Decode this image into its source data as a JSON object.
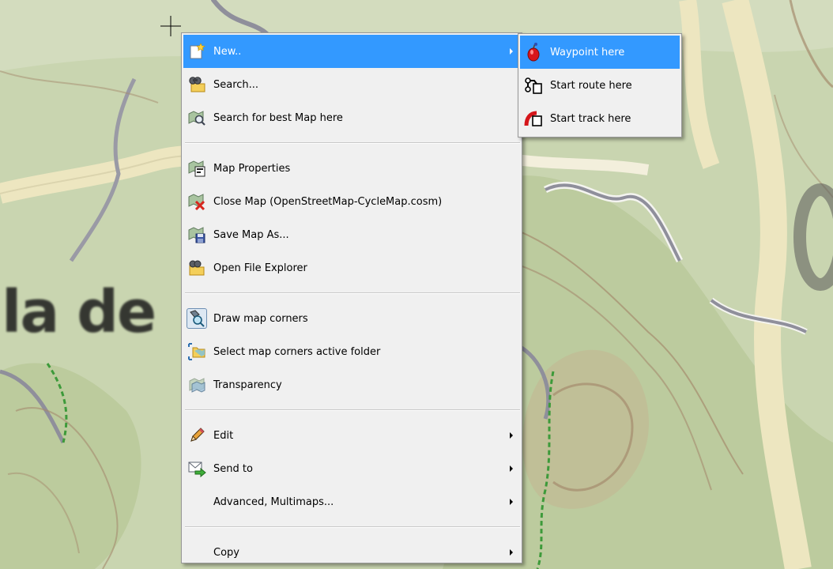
{
  "map": {
    "label_text": "la de",
    "colors": {
      "background": "#c7d3ad",
      "road": "#ede6c0",
      "contour": "#a58b6e",
      "boundary": "#8f8f9b",
      "trail": "#3d9a3a"
    }
  },
  "context_menu": {
    "items": [
      {
        "label": "New..",
        "icon": "new-item-icon",
        "submenu": true,
        "highlighted": true
      },
      {
        "label": "Search...",
        "icon": "search-folder-icon"
      },
      {
        "label": "Search for best Map here",
        "icon": "search-map-icon"
      },
      {
        "label": "Map Properties",
        "icon": "map-properties-icon"
      },
      {
        "label": "Close Map  (OpenStreetMap-CycleMap.cosm)",
        "icon": "close-map-icon"
      },
      {
        "label": "Save Map As...",
        "icon": "save-map-icon"
      },
      {
        "label": "Open File Explorer",
        "icon": "open-folder-icon"
      },
      {
        "label": "Draw map corners",
        "icon": "draw-corners-icon"
      },
      {
        "label": "Select map corners active folder",
        "icon": "corners-folder-icon"
      },
      {
        "label": "Transparency",
        "icon": "transparency-icon"
      },
      {
        "label": "Edit",
        "icon": "pencil-icon",
        "submenu": true
      },
      {
        "label": "Send to",
        "icon": "send-mail-icon",
        "submenu": true
      },
      {
        "label": "Advanced, Multimaps...",
        "submenu": true
      },
      {
        "label": "Copy",
        "submenu": true
      }
    ]
  },
  "new_submenu": {
    "items": [
      {
        "label": "Waypoint here",
        "icon": "waypoint-icon",
        "highlighted": true
      },
      {
        "label": "Start route here",
        "icon": "route-icon"
      },
      {
        "label": "Start track here",
        "icon": "track-icon"
      }
    ]
  },
  "colors": {
    "menu_bg": "#f0f0f0",
    "highlight": "#3399ff",
    "highlight_text": "#ffffff"
  }
}
